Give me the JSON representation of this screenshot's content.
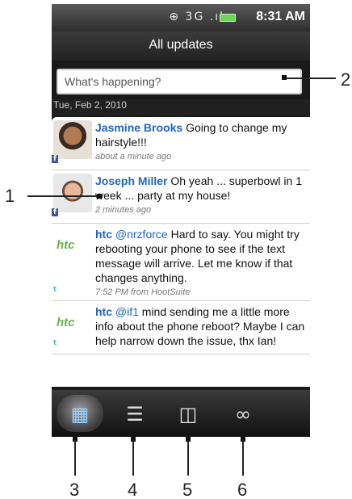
{
  "status_bar": {
    "icons_text": "⊕ 3G .ıl",
    "time": "8:31 AM"
  },
  "title_bar": {
    "title": "All updates"
  },
  "status_input": {
    "placeholder": "What's happening?"
  },
  "feed": {
    "date_header": "Tue, Feb 2, 2010",
    "items": [
      {
        "avatar": "person-photo",
        "source": "f",
        "name": "Jasmine Brooks",
        "mention": "",
        "text": "Going to change my hairstyle!!!",
        "meta": "about a minute ago"
      },
      {
        "avatar": "person-photo",
        "source": "f",
        "name": "Joseph Miller",
        "mention": "",
        "text": "Oh yeah ... superbowl in 1 week ... party at my house!",
        "meta": "2 minutes ago"
      },
      {
        "avatar": "htc",
        "source": "t",
        "name": "htc",
        "mention": "@nrzforce",
        "text": "Hard to say. You might try rebooting your phone to see if the text message will arrive. Let me know if that changes anything.",
        "meta": "7:52 PM from HootSuite"
      },
      {
        "avatar": "htc",
        "source": "t",
        "name": "htc",
        "mention": "@if1",
        "text": "mind sending me a little more info about the phone reboot? Maybe I can help narrow down the issue, thx Ian!",
        "meta": ""
      }
    ]
  },
  "tabs": [
    {
      "icon": "all-updates-icon",
      "active": true
    },
    {
      "icon": "status-updates-icon",
      "active": false
    },
    {
      "icon": "photos-icon",
      "active": false
    },
    {
      "icon": "links-icon",
      "active": false
    }
  ],
  "callouts": [
    "1",
    "2",
    "3",
    "4",
    "5",
    "6"
  ],
  "colors": {
    "accent_name": "#1f64c4",
    "htc_green": "#6ab04c",
    "facebook_blue": "#3b5998"
  }
}
